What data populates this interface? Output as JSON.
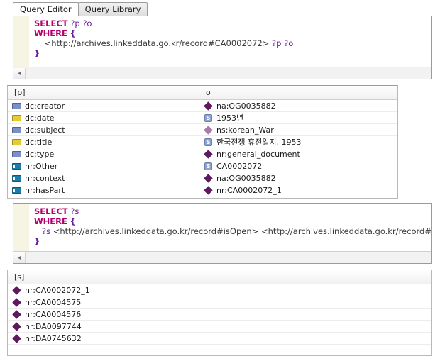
{
  "tabs": [
    {
      "label": "Query Editor",
      "active": true
    },
    {
      "label": "Query Library",
      "active": false
    }
  ],
  "editors": [
    {
      "name": "query-editor-top",
      "lines": [
        [
          {
            "t": "kw",
            "v": "SELECT"
          },
          {
            "t": "sp",
            "v": " "
          },
          {
            "t": "var",
            "v": "?p ?o"
          }
        ],
        [
          {
            "t": "kw",
            "v": "WHERE"
          },
          {
            "t": "sp",
            "v": " "
          },
          {
            "t": "brace",
            "v": "{"
          }
        ],
        [
          {
            "t": "sp",
            "v": "    "
          },
          {
            "t": "uri",
            "v": "<http://archives.linkeddata.go.kr/record#CA0002072>"
          },
          {
            "t": "sp",
            "v": " "
          },
          {
            "t": "var",
            "v": "?p ?o"
          }
        ],
        [
          {
            "t": "brace",
            "v": "}"
          }
        ]
      ],
      "scroll_arrow": "scroll-left-arrow"
    },
    {
      "name": "query-editor-bottom",
      "lines": [
        [
          {
            "t": "kw",
            "v": "SELECT"
          },
          {
            "t": "sp",
            "v": " "
          },
          {
            "t": "var",
            "v": "?s"
          }
        ],
        [
          {
            "t": "kw",
            "v": "WHERE"
          },
          {
            "t": "sp",
            "v": " "
          },
          {
            "t": "brace",
            "v": "{"
          }
        ],
        [
          {
            "t": "sp",
            "v": "   "
          },
          {
            "t": "var",
            "v": "?s"
          },
          {
            "t": "sp",
            "v": " "
          },
          {
            "t": "uri",
            "v": "<http://archives.linkeddata.go.kr/record#isOpen>"
          },
          {
            "t": "sp",
            "v": " "
          },
          {
            "t": "uri",
            "v": "<http://archives.linkeddata.go.kr/record#open>"
          }
        ],
        [
          {
            "t": "brace",
            "v": "}"
          }
        ]
      ],
      "scroll_arrow": "scroll-left-arrow"
    }
  ],
  "result_table_top": {
    "columns": [
      "[p]",
      "o"
    ],
    "rows": [
      {
        "p_icon": "periwinkle",
        "p": "dc:creator",
        "o_icon": "diamond-dark",
        "o": "na:OG0035882"
      },
      {
        "p_icon": "gold",
        "p": "dc:date",
        "o_icon": "literal",
        "o": "1953년"
      },
      {
        "p_icon": "periwinkle",
        "p": "dc:subject",
        "o_icon": "diamond-light",
        "o": "ns:korean_War"
      },
      {
        "p_icon": "gold",
        "p": "dc:title",
        "o_icon": "literal",
        "o": "한국전쟁 휴전일지, 1953"
      },
      {
        "p_icon": "periwinkle",
        "p": "dc:type",
        "o_icon": "diamond-dark",
        "o": "nr:general_document"
      },
      {
        "p_icon": "teal",
        "p": "nr:Other",
        "o_icon": "literal",
        "o": "CA0002072"
      },
      {
        "p_icon": "teal",
        "p": "nr:context",
        "o_icon": "diamond-dark",
        "o": "na:OG0035882"
      },
      {
        "p_icon": "teal",
        "p": "nr:hasPart",
        "o_icon": "diamond-dark",
        "o": "nr:CA0002072_1"
      }
    ]
  },
  "result_table_bottom": {
    "columns": [
      "[s]"
    ],
    "rows": [
      {
        "s_icon": "diamond-dark",
        "s": "nr:CA0002072_1"
      },
      {
        "s_icon": "diamond-dark",
        "s": "nr:CA0004575"
      },
      {
        "s_icon": "diamond-dark",
        "s": "nr:CA0004576"
      },
      {
        "s_icon": "diamond-dark",
        "s": "nr:DA0097744"
      },
      {
        "s_icon": "diamond-dark",
        "s": "nr:DA0745632"
      }
    ]
  },
  "literal_icon_glyph": "S",
  "colors": {
    "keyword": "#b3006b",
    "variable": "#6a1b9a",
    "icon_periwinkle": "#7b8fc9",
    "icon_gold": "#e3cd32",
    "icon_teal": "#1d7ca8",
    "diamond_dark": "#5d1a5d",
    "diamond_light": "#a87ca8",
    "literal_badge": "#8ea3cd"
  }
}
